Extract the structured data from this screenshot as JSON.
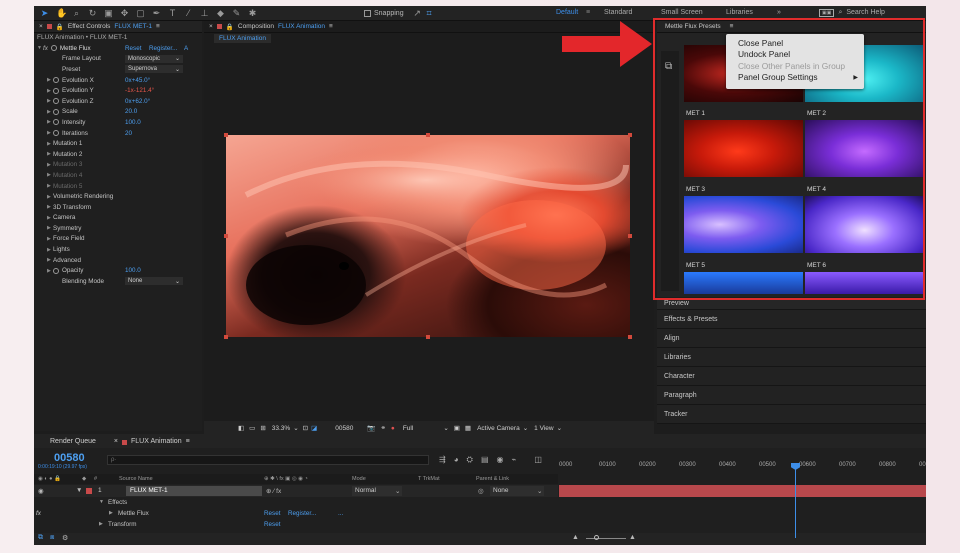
{
  "toolbar": {
    "snapping_label": "Snapping",
    "workspaces": [
      "Default",
      "Standard",
      "Small Screen",
      "Libraries"
    ],
    "active_workspace": "Default",
    "overflow": "»",
    "search_help": "Search Help"
  },
  "effect_controls": {
    "tab_prefix": "Effect Controls",
    "tab_layer": "FLUX MET-1",
    "breadcrumb": "FLUX Animation • FLUX MET-1",
    "fx_label": "fx",
    "effect_name": "Mettle Flux",
    "reset_label": "Reset",
    "register_label": "Register...",
    "about_label": "A",
    "properties": [
      {
        "name": "Frame Layout",
        "value": "Monoscopic",
        "kind": "select",
        "dim": false
      },
      {
        "name": "Preset",
        "value": "Supernova",
        "kind": "select",
        "dim": false
      },
      {
        "name": "Evolution X",
        "value": "0x+45.0°",
        "kind": "blue",
        "dim": false
      },
      {
        "name": "Evolution Y",
        "value": "-1x-121.4°",
        "kind": "red",
        "dim": false
      },
      {
        "name": "Evolution Z",
        "value": "0x+62.0°",
        "kind": "blue",
        "dim": false
      },
      {
        "name": "Scale",
        "value": "20.0",
        "kind": "blue",
        "dim": false
      },
      {
        "name": "Intensity",
        "value": "100.0",
        "kind": "blue",
        "dim": false
      },
      {
        "name": "Iterations",
        "value": "20",
        "kind": "blue",
        "dim": false
      },
      {
        "name": "Mutation 1",
        "value": "",
        "kind": "group",
        "dim": false
      },
      {
        "name": "Mutation 2",
        "value": "",
        "kind": "group",
        "dim": false
      },
      {
        "name": "Mutation 3",
        "value": "",
        "kind": "group",
        "dim": true
      },
      {
        "name": "Mutation 4",
        "value": "",
        "kind": "group",
        "dim": true
      },
      {
        "name": "Mutation 5",
        "value": "",
        "kind": "group",
        "dim": true
      },
      {
        "name": "Volumetric Rendering",
        "value": "",
        "kind": "group",
        "dim": false
      },
      {
        "name": "3D Transform",
        "value": "",
        "kind": "group",
        "dim": false
      },
      {
        "name": "Camera",
        "value": "",
        "kind": "group",
        "dim": false
      },
      {
        "name": "Symmetry",
        "value": "",
        "kind": "group",
        "dim": false
      },
      {
        "name": "Force Field",
        "value": "",
        "kind": "group",
        "dim": false
      },
      {
        "name": "Lights",
        "value": "",
        "kind": "group",
        "dim": false
      },
      {
        "name": "Advanced",
        "value": "",
        "kind": "group",
        "dim": false
      },
      {
        "name": "Opacity",
        "value": "100.0",
        "kind": "blue",
        "dim": false
      },
      {
        "name": "Blending Mode",
        "value": "None",
        "kind": "select",
        "dim": false
      }
    ]
  },
  "composition": {
    "tab_prefix": "Composition",
    "tab_name": "FLUX Animation",
    "sub_tab": "FLUX Animation",
    "zoom": "33.3%",
    "frame": "00580",
    "resolution": "Full",
    "camera": "Active Camera",
    "views": "1 View"
  },
  "presets_panel": {
    "title": "Mettle Flux Presets",
    "items": [
      "MET 1",
      "MET 2",
      "MET 3",
      "MET 4",
      "MET 5",
      "MET 6"
    ]
  },
  "context_menu": {
    "items": [
      {
        "label": "Close Panel",
        "disabled": false,
        "submenu": ""
      },
      {
        "label": "Undock Panel",
        "disabled": false,
        "submenu": ""
      },
      {
        "label": "Close Other Panels in Group",
        "disabled": true,
        "submenu": ""
      },
      {
        "label": "Panel Group Settings",
        "disabled": false,
        "submenu": "▶"
      }
    ]
  },
  "side_panels": [
    "Preview",
    "Effects & Presets",
    "Align",
    "Libraries",
    "Character",
    "Paragraph",
    "Tracker"
  ],
  "timeline": {
    "tab_render_queue": "Render Queue",
    "tab_comp": "FLUX Animation",
    "timecode": "00580",
    "fps_note": "0:00:19:10 (29.97 fps)",
    "search_placeholder": "ρ·",
    "columns": {
      "source_name": "Source Name",
      "mode": "Mode",
      "trkmat": "T TrkMat",
      "parent": "Parent & Link"
    },
    "layer": {
      "number": "1",
      "name": "FLUX MET-1",
      "mode": "Normal",
      "parent": "None"
    },
    "sub_rows": [
      {
        "label": "Effects",
        "indent": 1
      },
      {
        "label": "Mettle Flux",
        "indent": 2,
        "reset": "Reset",
        "register": "Register...",
        "extra": "..."
      },
      {
        "label": "Transform",
        "indent": 1,
        "reset": "Reset"
      }
    ],
    "ruler_marks": [
      "0000",
      "00100",
      "00200",
      "00300",
      "00400",
      "00500",
      "00600",
      "00700",
      "00800",
      "009"
    ]
  }
}
